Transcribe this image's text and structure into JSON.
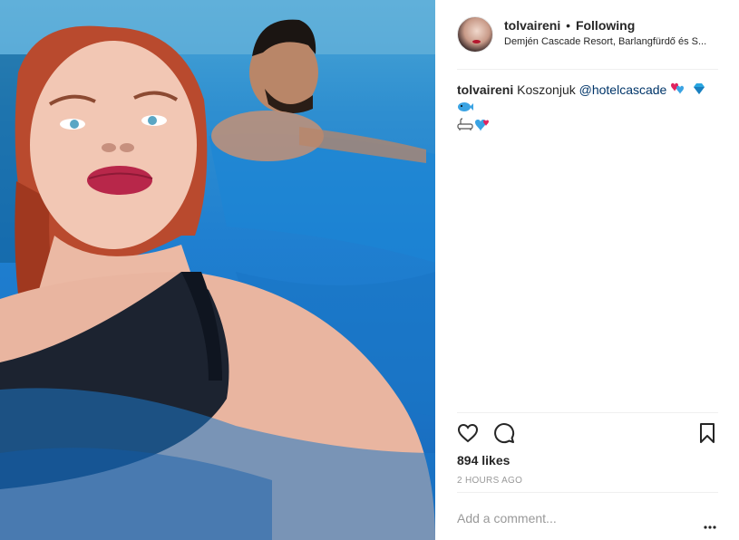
{
  "post": {
    "header": {
      "username": "tolvaireni",
      "separator": "•",
      "follow_state": "Following",
      "location": "Demjén Cascade Resort, Barlangfürdő és S..."
    },
    "caption": {
      "username": "tolvaireni",
      "text": "Koszonjuk",
      "mention": "@hotelcascade",
      "emojis": [
        "hearts-emoji",
        "gem-emoji",
        "fish-emoji",
        "bathtub-emoji",
        "heart-emoji"
      ]
    },
    "actions": {
      "icons": [
        "heart-outline-icon",
        "comment-bubble-icon",
        "bookmark-icon"
      ]
    },
    "likes": "894 likes",
    "timestamp": "2 HOURS AGO",
    "comment": {
      "placeholder": "Add a comment...",
      "more_icon": "more-dots-icon"
    },
    "colors": {
      "text": "#262626",
      "muted": "#999999",
      "link": "#003569",
      "divider": "#efefef",
      "pool_blue": "#1f7fd0"
    }
  }
}
